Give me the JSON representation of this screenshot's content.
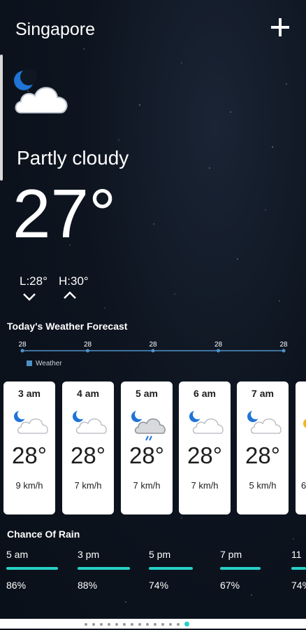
{
  "city": "Singapore",
  "condition": "Partly cloudy",
  "temperature": "27°",
  "low": "L:28°",
  "high": "H:30°",
  "forecast_title": "Today's Weather Forecast",
  "chart_data": {
    "type": "line",
    "values": [
      28,
      28,
      28,
      28,
      28
    ],
    "series": [
      {
        "name": "Weather",
        "values": [
          28,
          28,
          28,
          28,
          28
        ]
      }
    ],
    "title": "",
    "xlabel": "",
    "ylabel": "",
    "grid": false,
    "legend": "bottom-left",
    "color": "#4f91c7"
  },
  "hourly": [
    {
      "time": "3 am",
      "temp": "28°",
      "wind": "9 km/h",
      "icon": "moon-cloud-icon"
    },
    {
      "time": "4 am",
      "temp": "28°",
      "wind": "7 km/h",
      "icon": "moon-cloud-icon"
    },
    {
      "time": "5 am",
      "temp": "28°",
      "wind": "7 km/h",
      "icon": "moon-cloud-rain-icon"
    },
    {
      "time": "6 am",
      "temp": "28°",
      "wind": "7 km/h",
      "icon": "moon-cloud-icon"
    },
    {
      "time": "7 am",
      "temp": "28°",
      "wind": "5 km/h",
      "icon": "moon-cloud-icon"
    },
    {
      "time": "",
      "temp": "",
      "wind": "6",
      "icon": "sun-icon"
    }
  ],
  "rain_title": "Chance Of Rain",
  "rain": [
    {
      "time": "5 am",
      "pct": "86%"
    },
    {
      "time": "3 pm",
      "pct": "88%"
    },
    {
      "time": "5 pm",
      "pct": "74%"
    },
    {
      "time": "7 pm",
      "pct": "67%"
    },
    {
      "time": "11",
      "pct": "74%"
    }
  ],
  "pager": {
    "count": 14,
    "active": 13
  },
  "colors": {
    "accent": "#26d1c6",
    "moon": "#1f74d6",
    "line": "#4f91c7"
  }
}
